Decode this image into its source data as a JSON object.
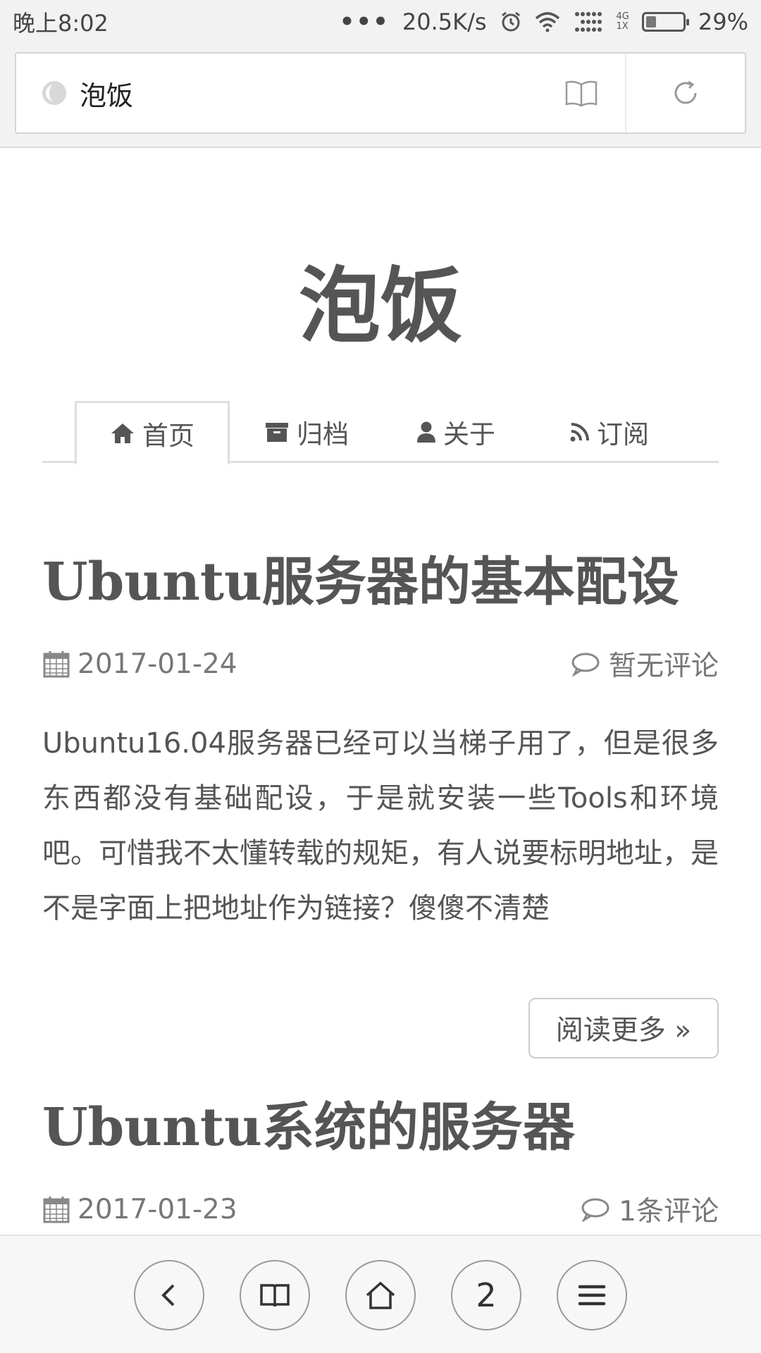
{
  "status_bar": {
    "time": "晚上8:02",
    "dots": "•••",
    "speed": "20.5K/s",
    "network_top": "4G",
    "network_bottom": "1X",
    "battery": "29%",
    "battery_level": 0.29
  },
  "address_bar": {
    "text": "泡饭"
  },
  "site": {
    "title": "泡饭"
  },
  "nav": {
    "items": [
      {
        "label": "首页",
        "icon": "home-icon",
        "active": true
      },
      {
        "label": "归档",
        "icon": "archive-icon",
        "active": false
      },
      {
        "label": "关于",
        "icon": "user-icon",
        "active": false
      },
      {
        "label": "订阅",
        "icon": "rss-icon",
        "active": false
      }
    ]
  },
  "posts": [
    {
      "title": "Ubuntu服务器的基本配设",
      "date": "2017-01-24",
      "comments": "暂无评论",
      "excerpt": "Ubuntu16.04服务器已经可以当梯子用了，但是很多东西都没有基础配设，于是就安装一些Tools和环境吧。可惜我不太懂转载的规矩，有人说要标明地址，是不是字面上把地址作为链接？傻傻不清楚",
      "read_more": "阅读更多 »"
    },
    {
      "title": "Ubuntu系统的服务器",
      "date": "2017-01-23",
      "comments": "1条评论"
    }
  ],
  "bottom_bar": {
    "tabs_count": "2",
    "icons": [
      "back-icon",
      "bookmarks-icon",
      "home-icon",
      "tabs-counter",
      "menu-icon"
    ]
  },
  "colors": {
    "text": "#555555",
    "meta": "#777777",
    "border": "#dedede",
    "chrome_bg": "#f2f2f2"
  }
}
